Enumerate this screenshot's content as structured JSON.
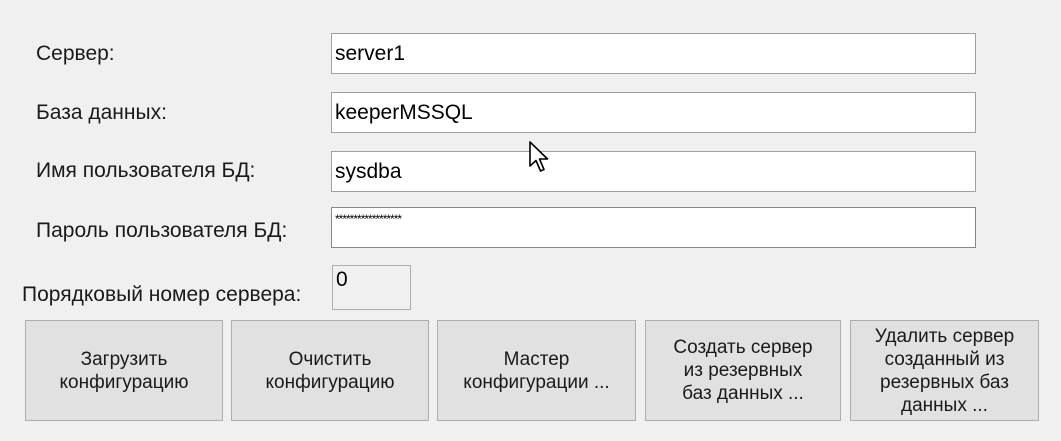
{
  "form": {
    "server_label": "Сервер:",
    "server_value": "server1",
    "database_label": "База данных:",
    "database_value": "keeperMSSQL",
    "db_user_label": "Имя пользователя БД:",
    "db_user_value": "sysdba",
    "db_password_label": "Пароль пользователя БД:",
    "db_password_value": "******************",
    "server_number_label": "Порядковый номер сервера:",
    "server_number_value": "0"
  },
  "buttons": {
    "load_config": "Загрузить\nконфигурацию",
    "clear_config": "Очистить\nконфигурацию",
    "config_wizard": "Мастер\nконфигурации ...",
    "create_from_backup": "Создать сервер\nиз резервных\nбаз данных ...",
    "delete_created_server": "Удалить сервер\nсозданный из\nрезервных баз\nданных ..."
  },
  "icons": {
    "cursor": "arrow-cursor-icon"
  },
  "colors": {
    "window_bg": "#f0f0f0",
    "button_bg": "#e1e1e1",
    "focus_border": "#5b8fd6"
  }
}
